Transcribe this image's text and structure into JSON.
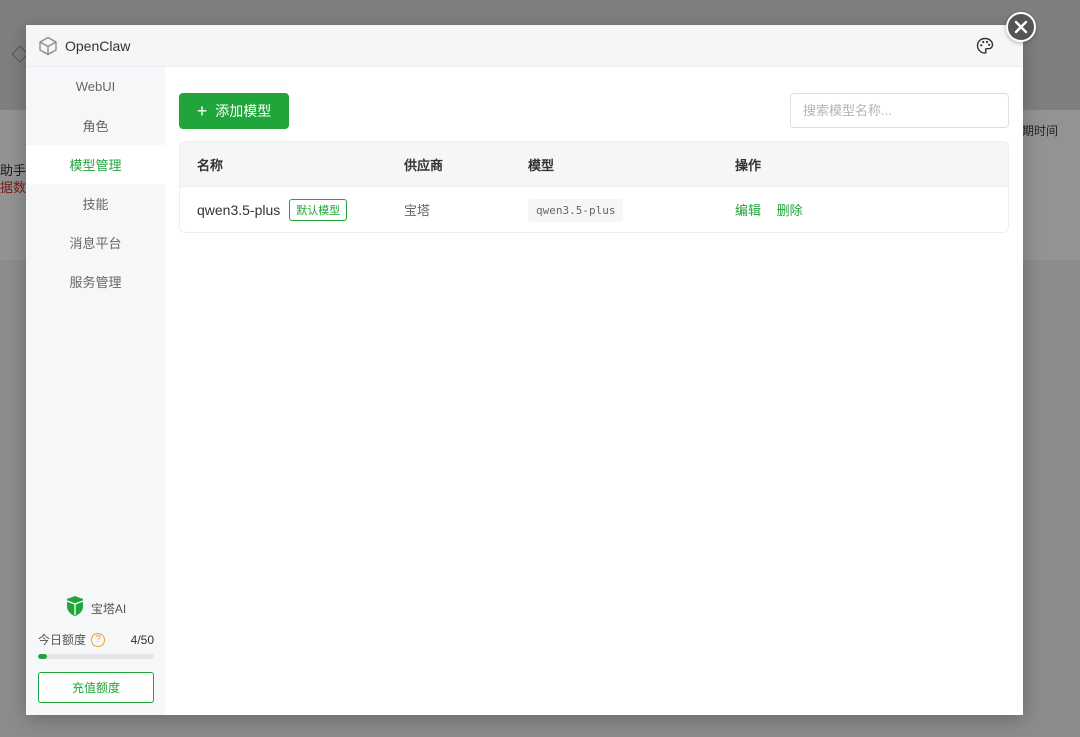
{
  "background": {
    "text_left_1": "助手，",
    "text_left_2": "据数据",
    "text_right": "期时间"
  },
  "modal": {
    "title": "OpenClaw",
    "logo_icon": "cube-icon",
    "theme_icon": "palette-icon",
    "close_icon": "close-icon"
  },
  "sidebar": {
    "items": [
      {
        "label": "WebUI",
        "active": false
      },
      {
        "label": "角色",
        "active": false
      },
      {
        "label": "模型管理",
        "active": true
      },
      {
        "label": "技能",
        "active": false
      },
      {
        "label": "消息平台",
        "active": false
      },
      {
        "label": "服务管理",
        "active": false
      }
    ],
    "brand_label": "宝塔AI",
    "quota_label": "今日额度",
    "quota_count": "4/50",
    "quota_used": 4,
    "quota_total": 50,
    "recharge_label": "充值额度"
  },
  "main": {
    "add_button_label": "添加模型",
    "search_placeholder": "搜索模型名称...",
    "table": {
      "headers": [
        "名称",
        "供应商",
        "模型",
        "操作"
      ],
      "rows": [
        {
          "name": "qwen3.5-plus",
          "badge": "默认模型",
          "provider": "宝塔",
          "model": "qwen3.5-plus",
          "actions": [
            "编辑",
            "删除"
          ]
        }
      ]
    }
  },
  "colors": {
    "accent": "#20a53a",
    "overlay": "#8c8c8c"
  }
}
